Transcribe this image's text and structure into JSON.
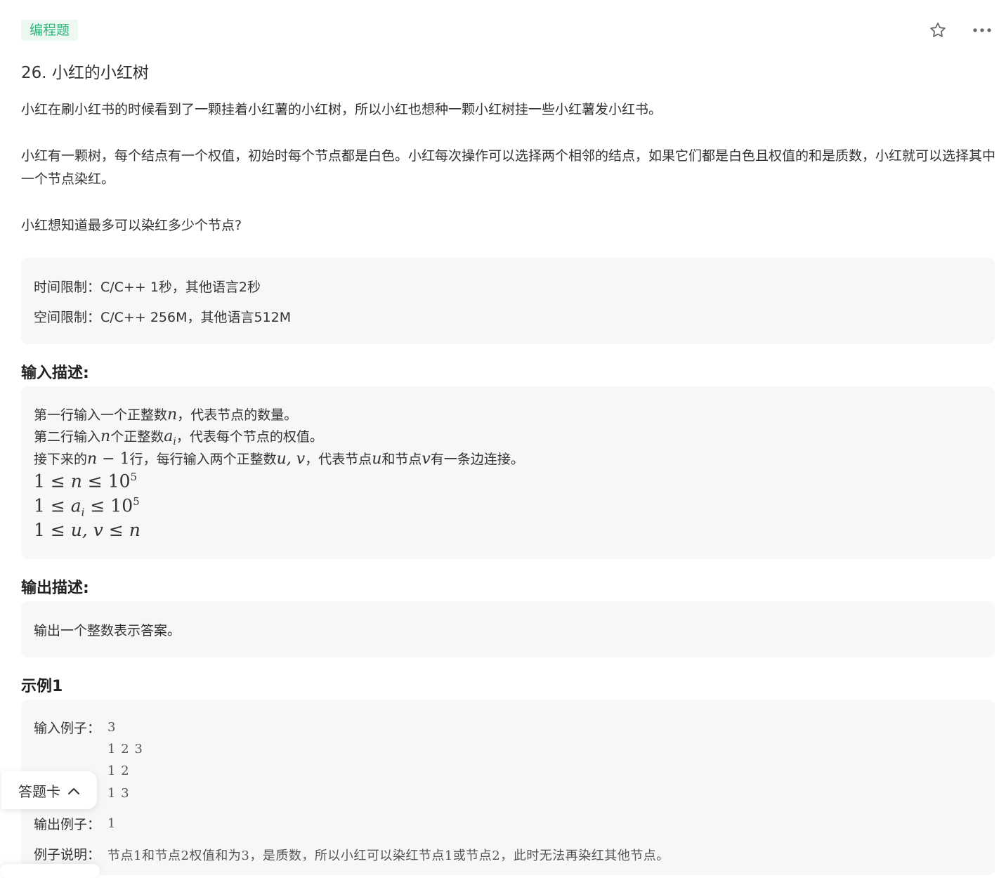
{
  "tag": "编程题",
  "icons": {
    "star": "star-icon",
    "more": "more-icon",
    "chevron": "chevron-up-icon"
  },
  "colors": {
    "tag_text": "#28b577",
    "tag_bg": "#eef8f3",
    "box_bg": "#f7f7f7"
  },
  "title": "26. 小红的小红树",
  "description": {
    "p1": "小红在刷小红书的时候看到了一颗挂着小红薯的小红树，所以小红也想种一颗小红树挂一些小红薯发小红书。",
    "p2": "小红有一颗树，每个结点有一个权值，初始时每个节点都是白色。小红每次操作可以选择两个相邻的结点，如果它们都是白色且权值的和是质数，小红就可以选择其中一个节点染红。",
    "p3": "小红想知道最多可以染红多少个节点?"
  },
  "limits": {
    "time": "时间限制：C/C++ 1秒，其他语言2秒",
    "space": "空间限制：C/C++ 256M，其他语言512M"
  },
  "input_section": {
    "heading": "输入描述:",
    "l1_a": "第一行输入一个正整数",
    "l1_var": "n",
    "l1_b": "，代表节点的数量。",
    "l2_a": "第二行输入",
    "l2_var": "n",
    "l2_b": "个正整数",
    "l2_var2": "a",
    "l2_sub": "i",
    "l2_c": "，代表每个节点的权值。",
    "l3_a": "接下来的",
    "l3_expr_v": "n",
    "l3_expr_rest": " − 1",
    "l3_b": "行，每行输入两个正整数",
    "l3_uv": "u, v",
    "l3_c": "，代表节点",
    "l3_u": "u",
    "l3_d": "和节点",
    "l3_v": "v",
    "l3_e": "有一条边连接。",
    "c1_left": "1 ≤ ",
    "c1_var": "n",
    "c1_right": " ≤ 10",
    "c1_sup": "5",
    "c2_left": "1 ≤ ",
    "c2_var": "a",
    "c2_sub": "i",
    "c2_right": " ≤ 10",
    "c2_sup": "5",
    "c3_left": "1 ≤ ",
    "c3_var": "u, v",
    "c3_mid": " ≤ ",
    "c3_var2": "n"
  },
  "output_section": {
    "heading": "输出描述:",
    "text": "输出一个整数表示答案。"
  },
  "example": {
    "heading": "示例1",
    "input_label": "输入例子：",
    "input_lines": [
      "3",
      "1 2 3",
      "1 2",
      "1 3"
    ],
    "output_label": "输出例子：",
    "output_value": "1",
    "explain_label": "例子说明：",
    "explain_text": "节点1和节点2权值和为3，是质数，所以小红可以染红节点1或节点2，此时无法再染红其他节点。"
  },
  "answer_card": {
    "label": "答题卡"
  }
}
